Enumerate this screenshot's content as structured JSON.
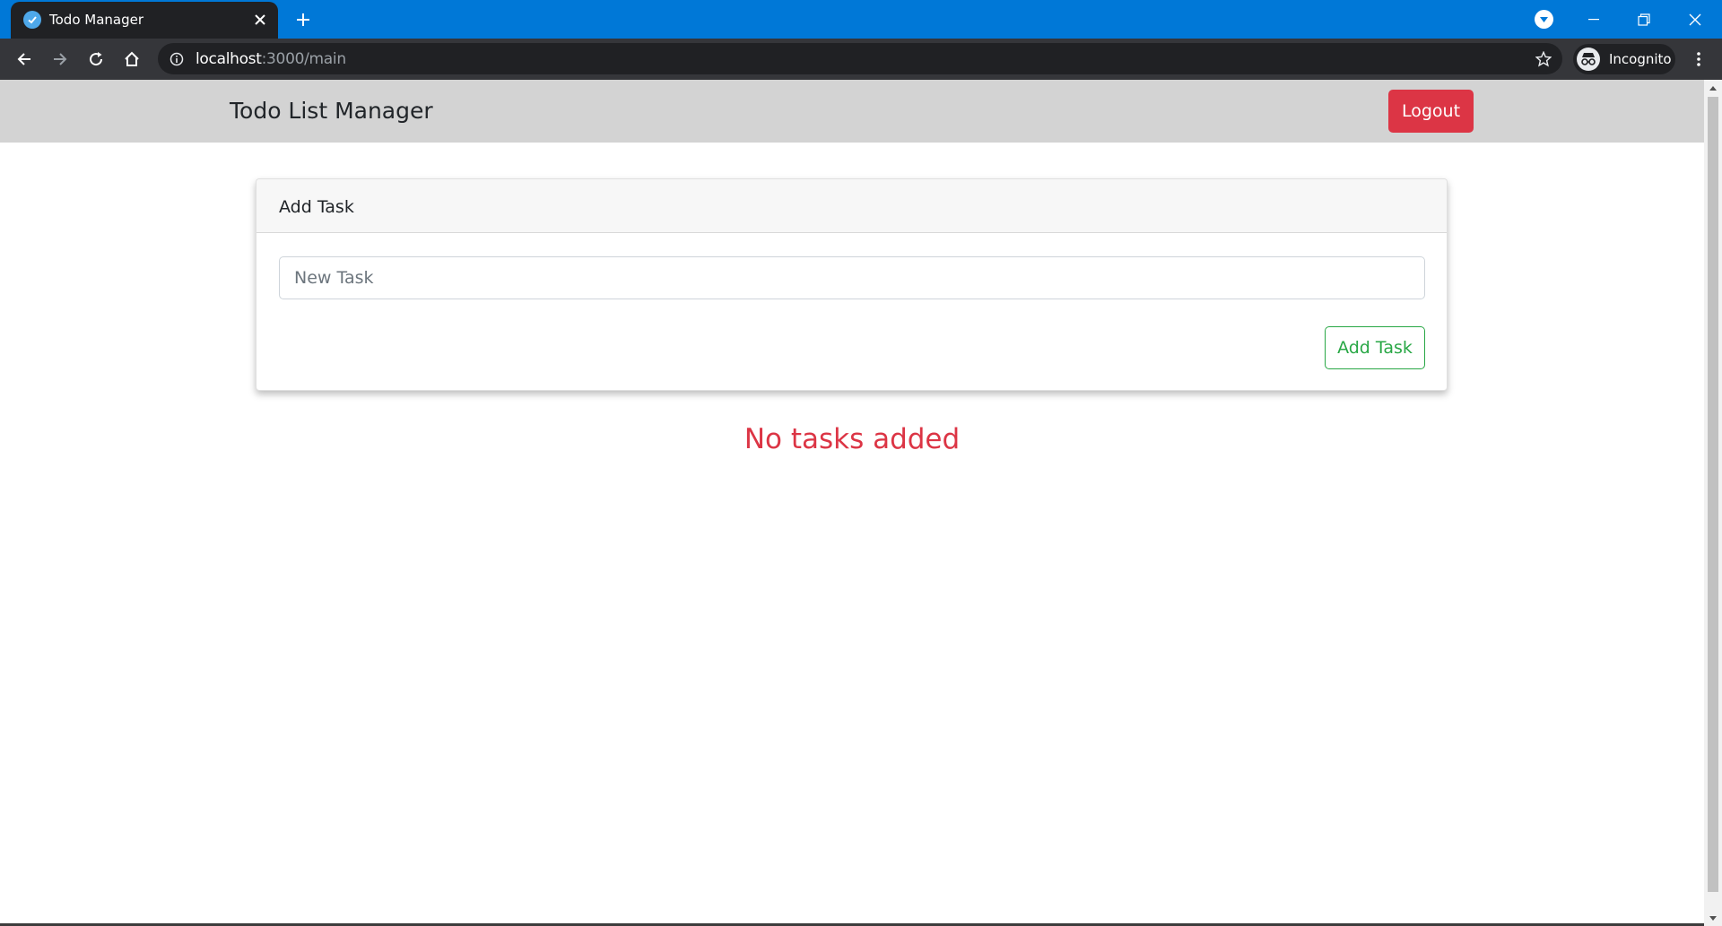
{
  "browser": {
    "tab_title": "Todo Manager",
    "url_host": "localhost",
    "url_rest": ":3000/main",
    "profile_label": "Incognito",
    "accent_color": "#0078d7"
  },
  "icons": {
    "favicon": "check-circle-icon",
    "close": "close-icon",
    "new_tab": "plus-icon",
    "back": "arrow-left-icon",
    "forward": "arrow-right-icon",
    "reload": "reload-icon",
    "home": "home-icon",
    "info": "info-icon",
    "star": "star-icon",
    "incognito": "incognito-icon",
    "menu": "more-vertical-icon"
  },
  "navbar": {
    "brand": "Todo List Manager",
    "logout_label": "Logout",
    "background": "#d3d3d3"
  },
  "add_task_card": {
    "header": "Add Task",
    "input_value": "",
    "input_placeholder": "New Task",
    "submit_label": "Add Task"
  },
  "task_list": {
    "empty_message": "No tasks added"
  },
  "colors": {
    "danger": "#dc3545",
    "success": "#28a745"
  }
}
